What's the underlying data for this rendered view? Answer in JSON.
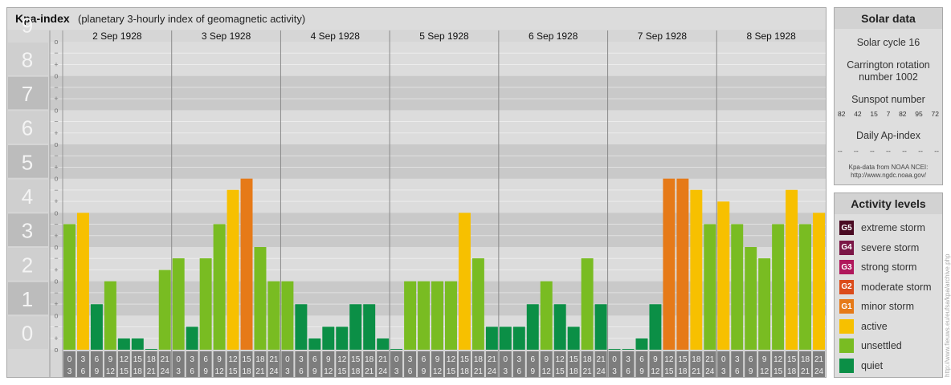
{
  "header": {
    "title": "Kpa-index",
    "subtitle": "(planetary 3-hourly index of geomagnetic activity)"
  },
  "chart_data": {
    "type": "bar",
    "ylim": [
      0,
      9
    ],
    "y_ticks": [
      "0",
      "1",
      "2",
      "3",
      "4",
      "5",
      "6",
      "7",
      "8",
      "9"
    ],
    "minor_ticks": [
      "o",
      "+",
      "−"
    ],
    "days": [
      "2 Sep 1928",
      "3 Sep 1928",
      "4 Sep 1928",
      "5 Sep 1928",
      "6 Sep 1928",
      "7 Sep 1928",
      "8 Sep 1928"
    ],
    "interval_labels": [
      [
        "0",
        "3"
      ],
      [
        "3",
        "6"
      ],
      [
        "6",
        "9"
      ],
      [
        "9",
        "12"
      ],
      [
        "12",
        "15"
      ],
      [
        "15",
        "18"
      ],
      [
        "18",
        "21"
      ],
      [
        "21",
        "24"
      ]
    ],
    "values": [
      [
        3.67,
        4.0,
        1.33,
        2.0,
        0.33,
        0.33,
        0.0,
        2.33
      ],
      [
        2.67,
        0.67,
        2.67,
        3.67,
        4.67,
        5.0,
        3.0,
        2.0
      ],
      [
        2.0,
        1.33,
        0.33,
        0.67,
        0.67,
        1.33,
        1.33,
        0.33
      ],
      [
        0.0,
        2.0,
        2.0,
        2.0,
        2.0,
        4.0,
        2.67,
        0.67
      ],
      [
        0.67,
        0.67,
        1.33,
        2.0,
        1.33,
        0.67,
        2.67,
        1.33
      ],
      [
        0.0,
        0.0,
        0.33,
        1.33,
        5.0,
        5.0,
        4.67,
        3.67
      ],
      [
        4.33,
        3.67,
        3.0,
        2.67,
        3.67,
        4.67,
        3.67,
        4.0
      ]
    ],
    "level_colors": {
      "quiet": "#0b8f46",
      "unsettled": "#79bc22",
      "active": "#f7c000",
      "G1": "#e67a18",
      "G2": "#db4b1a",
      "G3": "#b0165b",
      "G4": "#7b1646",
      "G5": "#4a0a22"
    }
  },
  "solar": {
    "title": "Solar data",
    "cycle": "Solar cycle 16",
    "carrington_line1": "Carrington rotation",
    "carrington_line2": "number 1002",
    "sunspot_label": "Sunspot number",
    "sunspot_values": [
      "82",
      "42",
      "15",
      "7",
      "82",
      "95",
      "72"
    ],
    "ap_label": "Daily Ap-index",
    "ap_values": [
      "--",
      "--",
      "--",
      "--",
      "--",
      "--",
      "--"
    ],
    "source_line1": "Kpa-data from NOAA NCEI:",
    "source_line2": "http://www.ngdc.noaa.gov/"
  },
  "legend": {
    "title": "Activity levels",
    "items": [
      {
        "badge": "G5",
        "label": "extreme storm",
        "color": "#4a0a22"
      },
      {
        "badge": "G4",
        "label": "severe storm",
        "color": "#7b1646"
      },
      {
        "badge": "G3",
        "label": "strong storm",
        "color": "#b0165b"
      },
      {
        "badge": "G2",
        "label": "moderate storm",
        "color": "#db4b1a"
      },
      {
        "badge": "G1",
        "label": "minor storm",
        "color": "#e67a18"
      },
      {
        "badge": "",
        "label": "active",
        "color": "#f7c000"
      },
      {
        "badge": "",
        "label": "unsettled",
        "color": "#79bc22"
      },
      {
        "badge": "",
        "label": "quiet",
        "color": "#0b8f46"
      }
    ]
  },
  "credit": "http://www.fieuws.eu/eufsa/kpa/archive.php"
}
